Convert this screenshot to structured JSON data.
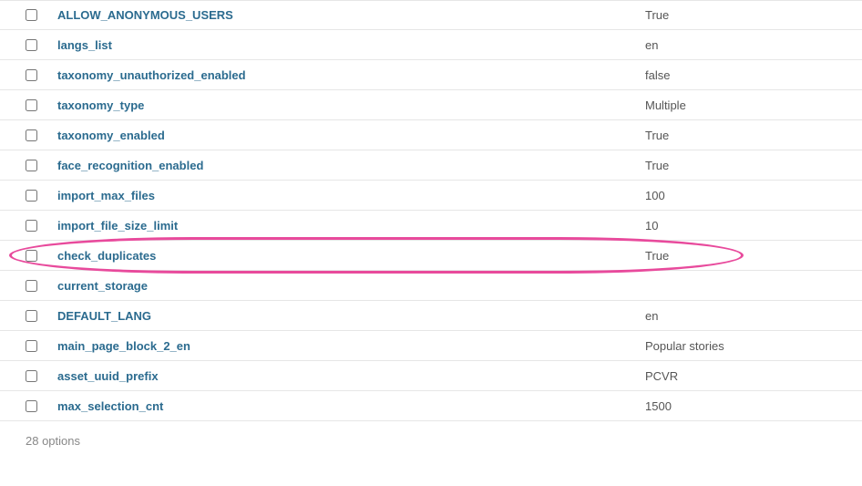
{
  "rows": [
    {
      "key": "ALLOW_ANONYMOUS_USERS",
      "value": "True",
      "highlighted": false
    },
    {
      "key": "langs_list",
      "value": "en",
      "highlighted": false
    },
    {
      "key": "taxonomy_unauthorized_enabled",
      "value": "false",
      "highlighted": false
    },
    {
      "key": "taxonomy_type",
      "value": "Multiple",
      "highlighted": false
    },
    {
      "key": "taxonomy_enabled",
      "value": "True",
      "highlighted": false
    },
    {
      "key": "face_recognition_enabled",
      "value": "True",
      "highlighted": false
    },
    {
      "key": "import_max_files",
      "value": "100",
      "highlighted": false
    },
    {
      "key": "import_file_size_limit",
      "value": "10",
      "highlighted": false
    },
    {
      "key": "check_duplicates",
      "value": "True",
      "highlighted": true
    },
    {
      "key": "current_storage",
      "value": "",
      "highlighted": false
    },
    {
      "key": "DEFAULT_LANG",
      "value": "en",
      "highlighted": false
    },
    {
      "key": "main_page_block_2_en",
      "value": "Popular stories",
      "highlighted": false
    },
    {
      "key": "asset_uuid_prefix",
      "value": "PCVR",
      "highlighted": false
    },
    {
      "key": "max_selection_cnt",
      "value": "1500",
      "highlighted": false
    }
  ],
  "footer": "28 options"
}
